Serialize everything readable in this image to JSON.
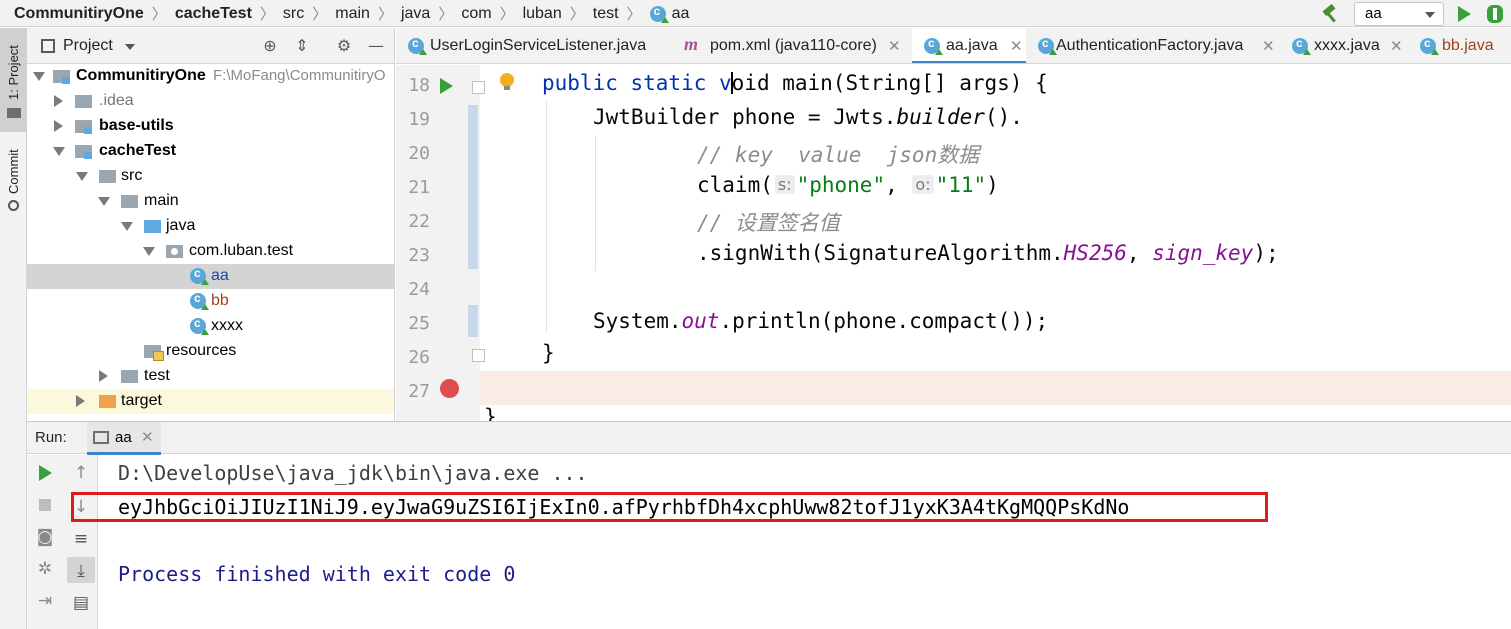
{
  "breadcrumb": {
    "items": [
      "CommunitiryOne",
      "cacheTest",
      "src",
      "main",
      "java",
      "com",
      "luban",
      "test",
      "aa"
    ],
    "bold": [
      true,
      true,
      false,
      false,
      false,
      false,
      false,
      false,
      false
    ]
  },
  "toolbar": {
    "run_config": "aa",
    "icons": [
      "build-hammer-icon",
      "run-icon",
      "debug-icon"
    ]
  },
  "left_stripe": {
    "project_tab": "1: Project",
    "commit_tab": "Commit"
  },
  "project_panel": {
    "title": "Project",
    "icons": [
      "locate-icon",
      "collapse-icon",
      "settings-icon",
      "minimize-icon"
    ],
    "tree": [
      {
        "label": "CommunitiryOne",
        "path": "F:\\MoFang\\CommunitiryO",
        "bold": true
      },
      {
        "label": ".idea"
      },
      {
        "label": "base-utils",
        "bold": true
      },
      {
        "label": "cacheTest",
        "bold": true
      },
      {
        "label": "src"
      },
      {
        "label": "main"
      },
      {
        "label": "java"
      },
      {
        "label": "com.luban.test"
      },
      {
        "label": "aa",
        "selected": true
      },
      {
        "label": "bb"
      },
      {
        "label": "xxxx"
      },
      {
        "label": "resources"
      },
      {
        "label": "test"
      },
      {
        "label": "target"
      }
    ]
  },
  "editor_tabs": [
    {
      "label": "UserLoginServiceListener.java",
      "icon": "java-class-icon"
    },
    {
      "label": "pom.xml (java110-core)",
      "icon": "maven-icon"
    },
    {
      "label": "aa.java",
      "icon": "java-class-icon",
      "active": true
    },
    {
      "label": "AuthenticationFactory.java",
      "icon": "java-class-icon"
    },
    {
      "label": "xxxx.java",
      "icon": "java-class-icon"
    },
    {
      "label": "bb.java",
      "icon": "java-class-icon"
    }
  ],
  "editor": {
    "line_numbers": [
      "18",
      "19",
      "20",
      "21",
      "22",
      "23",
      "24",
      "25",
      "26",
      "27"
    ],
    "code": {
      "l18_a": "public static v",
      "l18_b": "oid main(String[] args) {",
      "l19": "JwtBuilder phone = Jwts.",
      "l19_it": "builder",
      "l19_end": "().",
      "l20": "// key  value  json数据",
      "l21_a": "claim(",
      "l21_hint1": "s:",
      "l21_s1": "\"phone\"",
      "l21_comma": ", ",
      "l21_hint2": "o:",
      "l21_s2": "\"11\"",
      "l21_end": ")",
      "l22": "// 设置签名值",
      "l23_a": ".signWith(SignatureAlgorithm.",
      "l23_c1": "HS256",
      "l23_comma": ", ",
      "l23_c2": "sign_key",
      "l23_end": ");",
      "l25_a": "System.",
      "l25_out": "out",
      "l25_b": ".println(phone.compact());",
      "l26": "}",
      "l28": "}"
    }
  },
  "run_panel": {
    "title": "Run:",
    "tab_label": "aa",
    "console": {
      "command": "D:\\DevelopUse\\java_jdk\\bin\\java.exe ...",
      "output": "eyJhbGciOiJIUzI1NiJ9.eyJwaG9uZSI6IjExIn0.afPyrhbfDh4xcphUww82tofJ1yxK3A4tKgMQQPsKdNo",
      "finished": "Process finished with exit code 0"
    },
    "highlight_color": "#e01b1b"
  }
}
